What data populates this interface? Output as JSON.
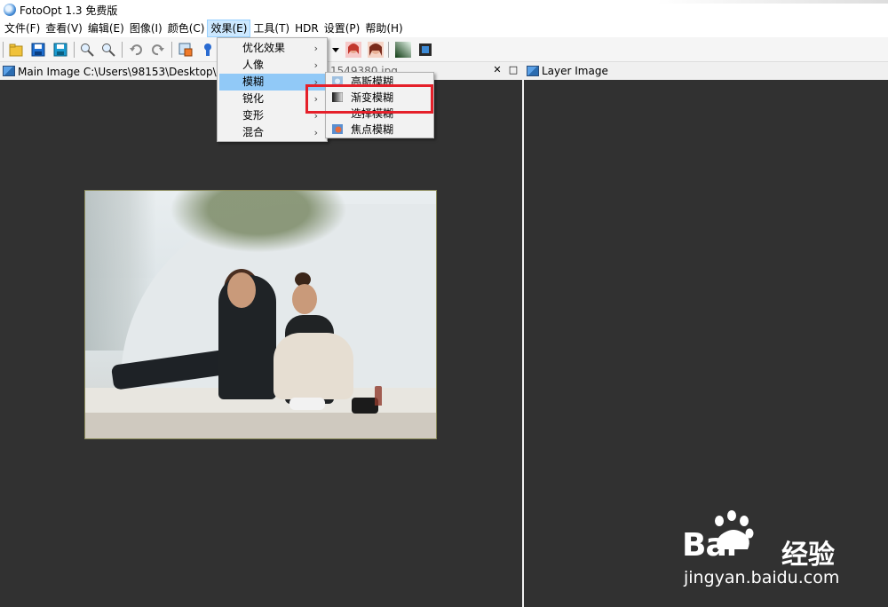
{
  "window": {
    "title": "FotoOpt 1.3 免费版"
  },
  "menubar": {
    "items": [
      "文件(F)",
      "查看(V)",
      "编辑(E)",
      "图像(I)",
      "颜色(C)",
      "效果(E)",
      "工具(T)",
      "HDR",
      "设置(P)",
      "帮助(H)"
    ],
    "active_index": 5
  },
  "panels": {
    "main_image_title": "Main Image C:\\Users\\98153\\Desktop\\存",
    "main_image_title_tail": "1549380.jpg",
    "layer_image_title": "Layer Image",
    "pin_symbol": "✕",
    "maximize_symbol": "□"
  },
  "effects_menu": {
    "items": [
      {
        "label": "优化效果",
        "has_submenu": true
      },
      {
        "label": "人像",
        "has_submenu": true
      },
      {
        "label": "模糊",
        "has_submenu": true,
        "highlighted": true
      },
      {
        "label": "锐化",
        "has_submenu": true
      },
      {
        "label": "变形",
        "has_submenu": true
      },
      {
        "label": "混合",
        "has_submenu": true
      }
    ],
    "arrow": "›"
  },
  "blur_submenu": {
    "items": [
      {
        "label": "高斯模糊",
        "icon": "gaussian-blur-icon"
      },
      {
        "label": "渐变模糊",
        "icon": "gradient-blur-icon",
        "annotated": true
      },
      {
        "label": "选择模糊",
        "icon": "selective-blur-icon"
      },
      {
        "label": "焦点模糊",
        "icon": "focus-blur-icon"
      }
    ]
  },
  "annotation": {
    "color": "#e5202a"
  },
  "watermark": {
    "brand": "Bai",
    "brand_cn": "经验",
    "url": "jingyan.baidu.com"
  },
  "colors": {
    "canvas_bg": "#313131",
    "menu_highlight": "#91c9f7",
    "active_menu": "#cce8ff"
  }
}
